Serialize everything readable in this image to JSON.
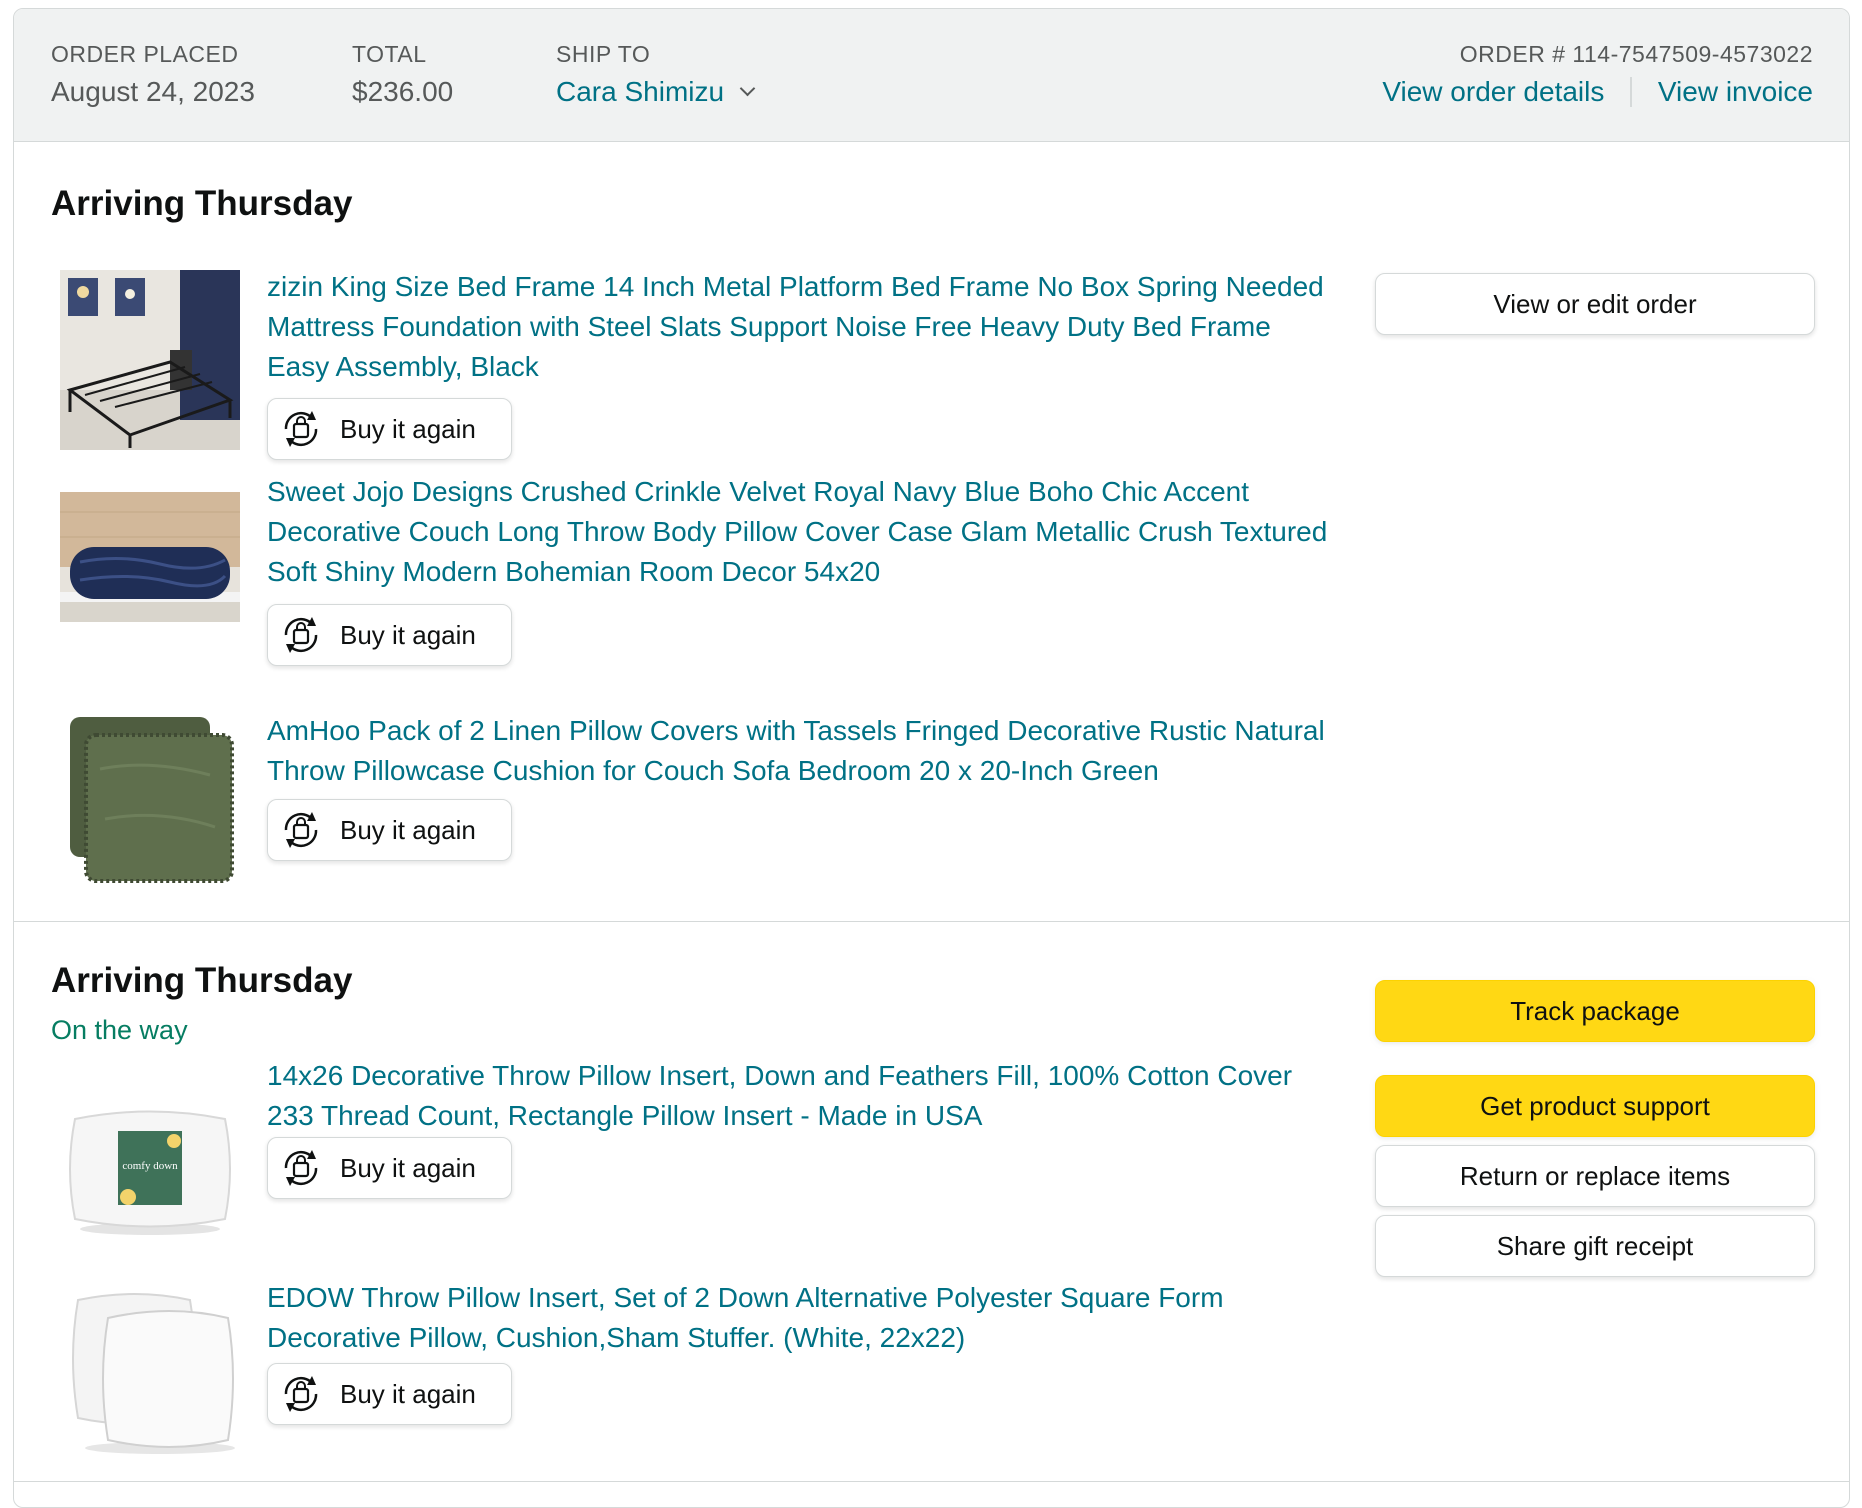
{
  "header": {
    "order_placed_label": "ORDER PLACED",
    "order_placed_value": "August 24, 2023",
    "total_label": "TOTAL",
    "total_value": "$236.00",
    "ship_to_label": "SHIP TO",
    "ship_to_value": "Cara Shimizu",
    "order_number": "ORDER # 114-7547509-4573022",
    "view_order_details": "View order details",
    "view_invoice": "View invoice"
  },
  "shipments": [
    {
      "title": "Arriving Thursday",
      "status": "",
      "actions": [
        "View or edit order"
      ],
      "items": [
        {
          "title": "zizin King Size Bed Frame 14 Inch Metal Platform Bed Frame No Box Spring Needed Mattress Foundation with Steel Slats Support Noise Free Heavy Duty Bed Frame Easy Assembly, Black",
          "buy_again": "Buy it again",
          "image": "bed-frame-image"
        },
        {
          "title": "Sweet Jojo Designs Crushed Crinkle Velvet Royal Navy Blue Boho Chic Accent Decorative Couch Long Throw Body Pillow Cover Case Glam Metallic Crush Textured Soft Shiny Modern Bohemian Room Decor 54x20",
          "buy_again": "Buy it again",
          "image": "navy-body-pillow-image"
        },
        {
          "title": "AmHoo Pack of 2 Linen Pillow Covers with Tassels Fringed Decorative Rustic Natural Throw Pillowcase Cushion for Couch Sofa Bedroom 20 x 20-Inch Green",
          "buy_again": "Buy it again",
          "image": "green-pillow-covers-image"
        }
      ]
    },
    {
      "title": "Arriving Thursday",
      "status": "On the way",
      "actions": [
        "Track package",
        "Get product support",
        "Return or replace items",
        "Share gift receipt"
      ],
      "items": [
        {
          "title": "14x26 Decorative Throw Pillow Insert, Down and Feathers Fill, 100% Cotton Cover 233 Thread Count, Rectangle Pillow Insert - Made in USA",
          "buy_again": "Buy it again",
          "image": "comfy-down-pillow-image",
          "image_text": "comfy down"
        },
        {
          "title": "EDOW Throw Pillow Insert, Set of 2 Down Alternative Polyester Square Form Decorative Pillow, Cushion,Sham Stuffer. (White, 22x22)",
          "buy_again": "Buy it again",
          "image": "white-pillow-inserts-image"
        }
      ]
    }
  ],
  "colors": {
    "link": "#007185",
    "status_green": "#067d62",
    "header_bg": "#f0f2f2",
    "border": "#d5d9d9",
    "yellow_button": "#ffd814"
  },
  "icons": [
    "chevron-down-icon",
    "buy-again-icon"
  ]
}
